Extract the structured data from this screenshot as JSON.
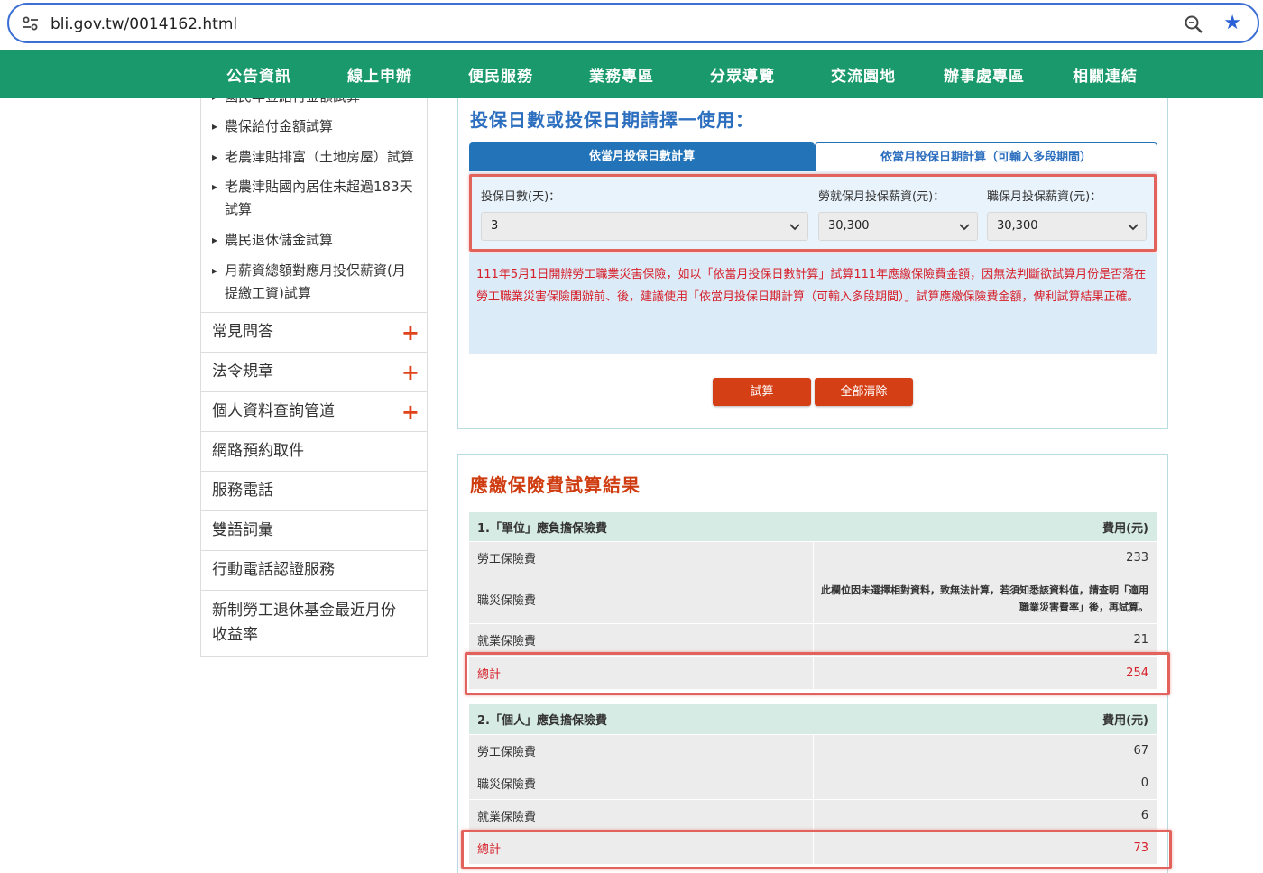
{
  "browser": {
    "url": "bli.gov.tw/0014162.html"
  },
  "nav": {
    "items": [
      "公告資訊",
      "線上申辦",
      "便民服務",
      "業務專區",
      "分眾導覽",
      "交流園地",
      "辦事處專區",
      "相關連結"
    ]
  },
  "sidebar": {
    "cut_item": "國民年金給付金額試算",
    "sub_items": [
      "農保給付金額試算",
      "老農津貼排富（土地房屋）試算",
      "老農津貼國內居住未超過183天",
      "試算",
      "農民退休儲金試算",
      "月薪資總額對應月投保薪資(月",
      "提繳工資)試算"
    ],
    "menu": [
      {
        "label": "常見問答",
        "plus": "+"
      },
      {
        "label": "法令規章",
        "plus": "+"
      },
      {
        "label": "個人資料查詢管道",
        "plus": "+"
      },
      {
        "label": "網路預約取件"
      },
      {
        "label": "服務電話"
      },
      {
        "label": "雙語詞彙"
      },
      {
        "label": "行動電話認證服務"
      },
      {
        "label": "新制勞工退休基金最近月份",
        "label2": "收益率"
      }
    ]
  },
  "calculator": {
    "heading": "投保日數或投保日期請擇一使用：",
    "tabs": [
      "依當月投保日數計算",
      "依當月投保日期計算（可輸入多段期間）"
    ],
    "fields": {
      "days_label": "投保日數(天)：",
      "days_value": "3",
      "labor_label": "勞就保月投保薪資(元)：",
      "labor_value": "30,300",
      "occ_label": "職保月投保薪資(元)：",
      "occ_value": "30,300"
    },
    "notice": "111年5月1日開辦勞工職業災害保險，如以「依當月投保日數計算」試算111年應繳保險費金額，因無法判斷欲試算月份是否落在勞工職業災害保險開辦前、後，建議使用「依當月投保日期計算（可輸入多段期間）」試算應繳保險費金額，俾利試算結果正確。",
    "buttons": {
      "calc": "試算",
      "clear": "全部清除"
    }
  },
  "results": {
    "title": "應繳保險費試算結果",
    "employer": {
      "header": "1.「單位」應負擔保險費",
      "fee_header": "費用(元)",
      "rows": [
        {
          "label": "勞工保險費",
          "value": "233"
        },
        {
          "label": "職災保險費",
          "value": "此欄位因未選擇相對資料，致無法計算，若須知悉該資料值，請查明「適用職業災害費率」後，再試算。"
        },
        {
          "label": "就業保險費",
          "value": "21"
        }
      ],
      "total_label": "總計",
      "total_value": "254"
    },
    "personal": {
      "header": "2.「個人」應負擔保險費",
      "fee_header": "費用(元)",
      "rows": [
        {
          "label": "勞工保險費",
          "value": "67"
        },
        {
          "label": "職災保險費",
          "value": "0"
        },
        {
          "label": "就業保險費",
          "value": "6"
        }
      ],
      "total_label": "總計",
      "total_value": "73"
    }
  },
  "colors": {
    "nav_green": "#1a9a6c",
    "tab_blue": "#2273b8",
    "button_red": "#d53f16",
    "highlight": "#e2625c",
    "notice_red": "#d6202a"
  }
}
